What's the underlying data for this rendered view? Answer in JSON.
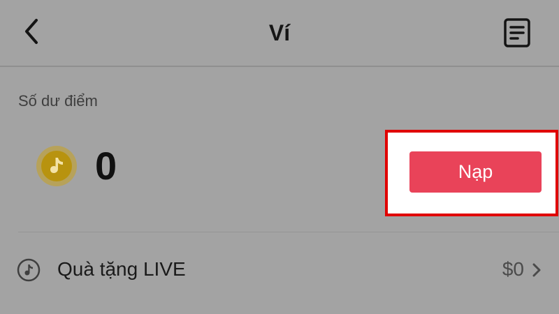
{
  "header": {
    "title": "Ví",
    "back_icon": "chevron-left-icon",
    "transactions_icon": "document-list-icon"
  },
  "balance": {
    "label": "Số dư điểm",
    "value": "0",
    "coin_icon": "tiktok-coin-icon",
    "recharge_label": "Nạp"
  },
  "live_gifts": {
    "label": "Quà tặng LIVE",
    "amount": "$0",
    "icon": "tiktok-logo-icon",
    "chevron_icon": "chevron-right-icon"
  },
  "colors": {
    "background": "#a3a3a3",
    "recharge_button": "#e94359",
    "highlight_border": "#e00000",
    "coin": "#c9a21f"
  }
}
